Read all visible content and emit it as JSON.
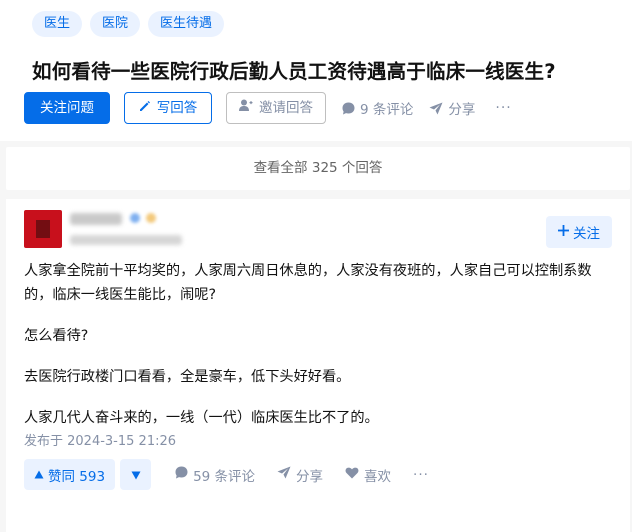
{
  "question": {
    "topics": [
      "医生",
      "医院",
      "医生待遇"
    ],
    "title": "如何看待一些医院行政后勤人员工资待遇高于临床一线医生?",
    "actions": {
      "follow_label": "关注问题",
      "write_label": "写回答",
      "invite_label": "邀请回答",
      "comments_label": "9 条评论",
      "share_label": "分享",
      "more_label": "···"
    }
  },
  "view_all_label": "查看全部 325 个回答",
  "answer": {
    "follow_label": "关注",
    "paragraphs": [
      "人家拿全院前十平均奖的，人家周六周日休息的，人家没有夜班的，人家自己可以控制系数的，临床一线医生能比，闹呢?",
      "怎么看待?",
      "去医院行政楼门口看看，全是豪车，低下头好好看。",
      "人家几代人奋斗来的，一线（一代）临床医生比不了的。"
    ],
    "published": "发布于 2024-3-15 21:26",
    "vote_label": "赞同 593",
    "comments_label": "59 条评论",
    "share_label": "分享",
    "like_label": "喜欢",
    "more_label": "···"
  },
  "colors": {
    "brand_blue": "#056de8",
    "light_blue_bg": "#eaf2ff",
    "meta_gray": "#8590a6",
    "avatar_red": "#c8101c"
  }
}
